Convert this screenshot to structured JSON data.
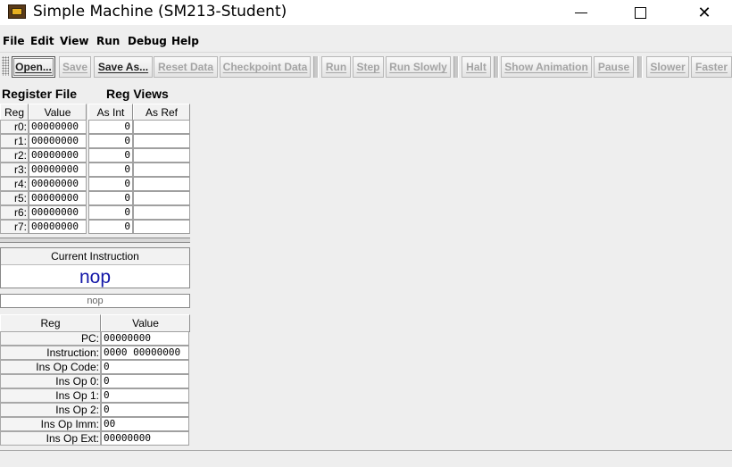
{
  "window": {
    "title": "Simple Machine (SM213-Student)",
    "min_icon": "minimize-icon",
    "max_icon": "maximize-icon",
    "close_glyph": "✕"
  },
  "menu": [
    "File",
    "Edit",
    "View",
    "Run",
    "Debug",
    "Help"
  ],
  "toolbar": {
    "open": "Open...",
    "save": "Save",
    "save_as": "Save As...",
    "reset_data": "Reset Data",
    "checkpoint_data": "Checkpoint Data",
    "run": "Run",
    "step": "Step",
    "run_slowly": "Run Slowly",
    "halt": "Halt",
    "show_animation": "Show Animation",
    "pause": "Pause",
    "slower": "Slower",
    "faster": "Faster"
  },
  "register_file": {
    "title": "Register File",
    "col_reg": "Reg",
    "col_value": "Value",
    "rows": [
      {
        "reg": "r0:",
        "value": "00000000"
      },
      {
        "reg": "r1:",
        "value": "00000000"
      },
      {
        "reg": "r2:",
        "value": "00000000"
      },
      {
        "reg": "r3:",
        "value": "00000000"
      },
      {
        "reg": "r4:",
        "value": "00000000"
      },
      {
        "reg": "r5:",
        "value": "00000000"
      },
      {
        "reg": "r6:",
        "value": "00000000"
      },
      {
        "reg": "r7:",
        "value": "00000000"
      }
    ]
  },
  "reg_views": {
    "title": "Reg Views",
    "col_int": "As Int",
    "col_ref": "As Ref",
    "rows": [
      {
        "as_int": "0",
        "as_ref": ""
      },
      {
        "as_int": "0",
        "as_ref": ""
      },
      {
        "as_int": "0",
        "as_ref": ""
      },
      {
        "as_int": "0",
        "as_ref": ""
      },
      {
        "as_int": "0",
        "as_ref": ""
      },
      {
        "as_int": "0",
        "as_ref": ""
      },
      {
        "as_int": "0",
        "as_ref": ""
      },
      {
        "as_int": "0",
        "as_ref": ""
      }
    ]
  },
  "current_instruction": {
    "header": "Current Instruction",
    "value": "nop",
    "secondary": "nop"
  },
  "cpu_registers": {
    "col_reg": "Reg",
    "col_value": "Value",
    "rows": [
      {
        "reg": "PC:",
        "value": "00000000"
      },
      {
        "reg": "Instruction:",
        "value": "0000 00000000"
      },
      {
        "reg": "Ins Op Code:",
        "value": "0"
      },
      {
        "reg": "Ins Op 0:",
        "value": "0"
      },
      {
        "reg": "Ins Op 1:",
        "value": "0"
      },
      {
        "reg": "Ins Op 2:",
        "value": "0"
      },
      {
        "reg": "Ins Op Imm:",
        "value": "00"
      },
      {
        "reg": "Ins Op Ext:",
        "value": "00000000"
      }
    ]
  },
  "colors": {
    "instruction_text": "#1418a8",
    "disabled_text": "#a4a4a4"
  }
}
